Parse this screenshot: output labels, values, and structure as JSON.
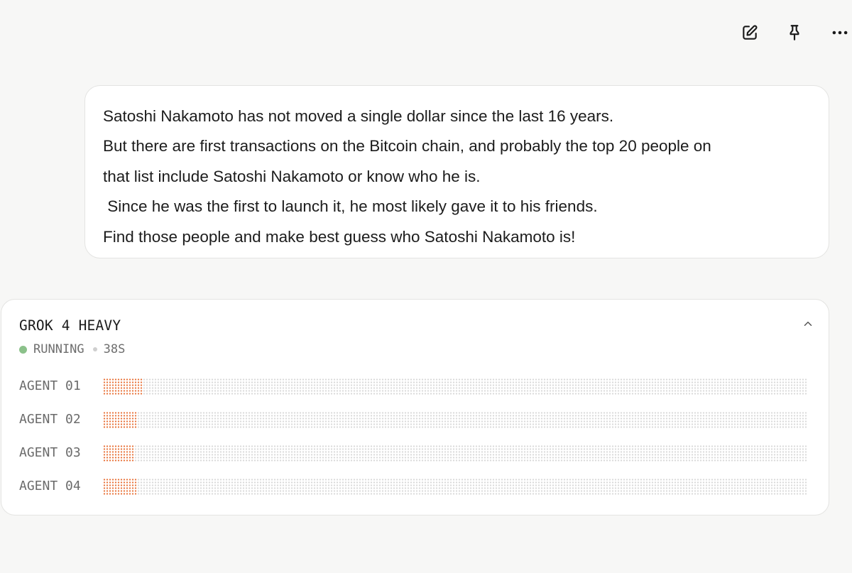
{
  "toolbar": {
    "icons": [
      "edit-icon",
      "pin-icon",
      "more-icon"
    ]
  },
  "message": {
    "lines": [
      "Satoshi Nakamoto has not moved a single dollar since the last 16 years.",
      "But there are first transactions on the Bitcoin chain, and probably the top 20 people on",
      "that list include Satoshi Nakamoto or know who he is.",
      " Since he was the first to launch it, he most likely gave it to his friends.",
      "Find those people and make best guess who Satoshi Nakamoto is!"
    ]
  },
  "run": {
    "model": "GROK 4 HEAVY",
    "status": "RUNNING",
    "elapsed": "38S",
    "status_color": "#8bc18a",
    "progress_color": "#e8733a",
    "track_color": "#d9d9d9",
    "agents": [
      {
        "label": "AGENT 01",
        "progress": 0.055
      },
      {
        "label": "AGENT 02",
        "progress": 0.049
      },
      {
        "label": "AGENT 03",
        "progress": 0.043
      },
      {
        "label": "AGENT 04",
        "progress": 0.049
      }
    ]
  }
}
